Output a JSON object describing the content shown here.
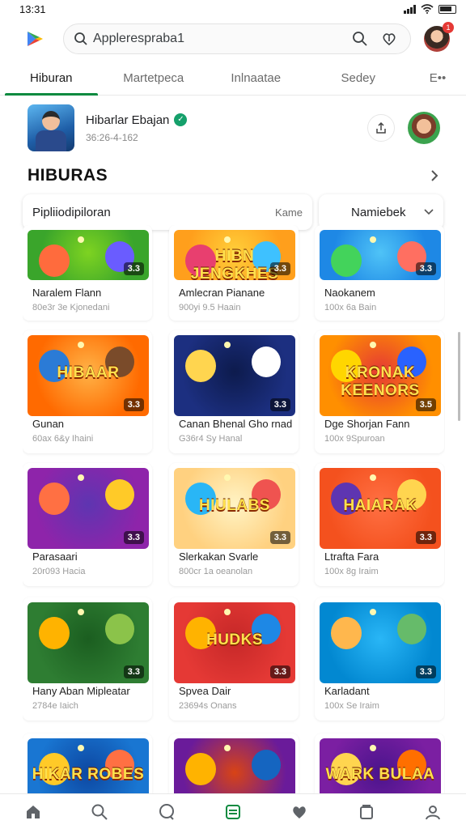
{
  "status": {
    "time": "13:31"
  },
  "header": {
    "search_query": "Applerespraba1",
    "notification_count": "1"
  },
  "tabs": [
    {
      "label": "Hiburan",
      "active": true
    },
    {
      "label": "Martetpeca",
      "active": false
    },
    {
      "label": "Inlnaatae",
      "active": false
    },
    {
      "label": "Sedey",
      "active": false
    },
    {
      "label": "E••",
      "active": false
    }
  ],
  "profile": {
    "name": "Hibarlar Ebajan",
    "subtitle": "36:26-4-162"
  },
  "section": {
    "title": "HIBURAS"
  },
  "filters": {
    "left_label": "Pipliiodipiloran",
    "left_small": "Kame",
    "right_label": "Namiebek"
  },
  "cards": [
    {
      "title": "Naralem Flann",
      "sub": "80e3r 3e Kjonedani",
      "age": "3.3",
      "art_text": "",
      "theme": "t1"
    },
    {
      "title": "Amlecran Pianane",
      "sub": "900yi 9.5 Haain",
      "age": "3.3",
      "art_text": "HIBN JENGKHES",
      "theme": "t2"
    },
    {
      "title": "Naokanem",
      "sub": "100x 6a Bain",
      "age": "3.3",
      "art_text": "",
      "theme": "t3"
    },
    {
      "title": "Gunan",
      "sub": "60ax 6&y Ihaini",
      "age": "3.3",
      "art_text": "HIBAAR",
      "theme": "t4"
    },
    {
      "title": "Canan Bhenal Gho rnad",
      "sub": "G36r4 Sy Hanal",
      "age": "3.3",
      "art_text": "",
      "theme": "t5"
    },
    {
      "title": "Dge Shorjan Fann",
      "sub": "100x 9Spuroan",
      "age": "3.5",
      "art_text": "KRONAK KEENORS",
      "theme": "t6"
    },
    {
      "title": "Parasaari",
      "sub": "20r093 Hacia",
      "age": "3.3",
      "art_text": "",
      "theme": "t7"
    },
    {
      "title": "Slerkakan Svarle",
      "sub": "800cr 1a oeanolan",
      "age": "3.3",
      "art_text": "HIULABS",
      "theme": "t8"
    },
    {
      "title": "Ltrafta Fara",
      "sub": "100x 8g Iraim",
      "age": "3.3",
      "art_text": "HAIARAK",
      "theme": "t9"
    },
    {
      "title": "Hany Aban Mipleatar",
      "sub": "2784e Iaich",
      "age": "3.3",
      "art_text": "",
      "theme": "t10"
    },
    {
      "title": "Spvea Dair",
      "sub": "23694s Onans",
      "age": "3.3",
      "art_text": "HUDKS",
      "theme": "t11"
    },
    {
      "title": "Karladant",
      "sub": "100x Se Iraim",
      "age": "3.3",
      "art_text": "",
      "theme": "t12"
    },
    {
      "title": "",
      "sub": "",
      "age": "",
      "art_text": "HIKAR ROBES",
      "theme": "t13"
    },
    {
      "title": "",
      "sub": "",
      "age": "",
      "art_text": "",
      "theme": "t14"
    },
    {
      "title": "",
      "sub": "",
      "age": "",
      "art_text": "WARK BULAA",
      "theme": "t15"
    }
  ],
  "bottom_nav": [
    {
      "icon": "home-icon"
    },
    {
      "icon": "search-icon"
    },
    {
      "icon": "chat-icon"
    },
    {
      "icon": "apps-icon"
    },
    {
      "icon": "heart-icon"
    },
    {
      "icon": "library-icon"
    },
    {
      "icon": "profile-icon"
    }
  ],
  "colors": {
    "accent": "#0b8a3f",
    "verified": "#15a06b",
    "badge": "#e53935"
  }
}
